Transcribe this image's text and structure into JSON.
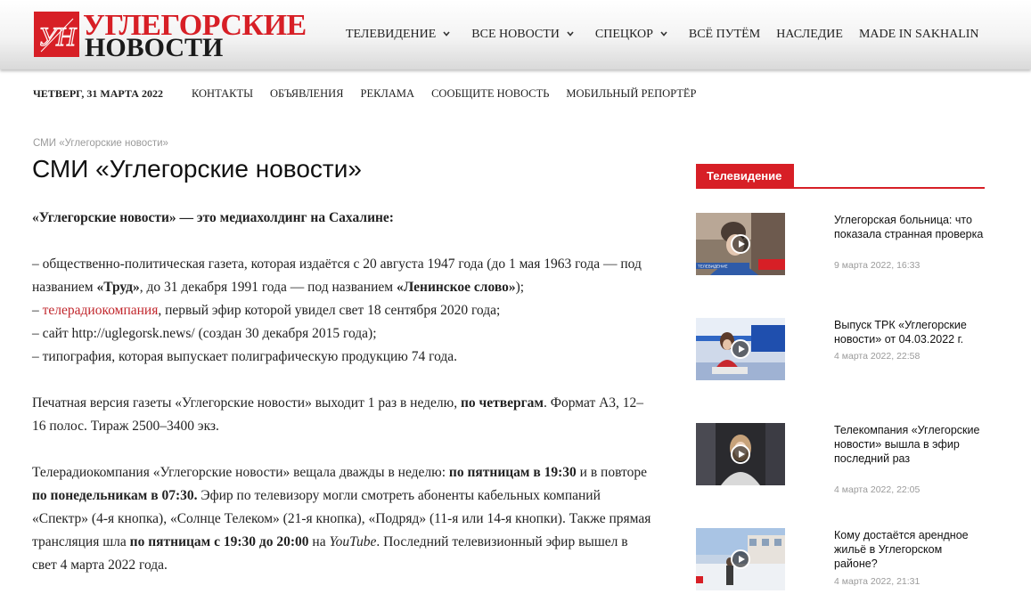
{
  "logo": {
    "line1": "УГЛЕГОРСКИЕ",
    "line2": "НОВОСТИ",
    "mark_text": "УН",
    "brand_color": "#d71f26"
  },
  "main_nav": [
    {
      "label": "ТЕЛЕВИДЕНИЕ",
      "dropdown": true
    },
    {
      "label": "ВСЕ НОВОСТИ",
      "dropdown": true
    },
    {
      "label": "СПЕЦКОР",
      "dropdown": true
    },
    {
      "label": "ВСЁ ПУТЁМ",
      "dropdown": false
    },
    {
      "label": "НАСЛЕДИЕ",
      "dropdown": false
    },
    {
      "label": "MADE IN SAKHALIN",
      "dropdown": false
    }
  ],
  "top_bar": {
    "date": "ЧЕТВЕРГ, 31 МАРТА 2022",
    "links": [
      "КОНТАКТЫ",
      "ОБЪЯВЛЕНИЯ",
      "РЕКЛАМА",
      "СООБЩИТЕ НОВОСТЬ",
      "МОБИЛЬНЫЙ РЕПОРТЁР"
    ]
  },
  "breadcrumb": "СМИ «Углегорские новости»",
  "page_title": "СМИ «Углегорские новости»",
  "article": {
    "intro": "«Углегорские новости» — это медиахолдинг на Сахалине:",
    "l1_a": "– общественно-политическая газета, которая издаётся с 20 августа 1947 года (до 1 мая 1963 года — под названием ",
    "l1_b": "«Труд»",
    "l1_c": ", до 31 декабря 1991 года — под названием ",
    "l1_d": "«Ленинское слово»",
    "l1_e": ");",
    "l2_a": "– ",
    "l2_link": "телерадиокомпания",
    "l2_b": ", первый эфир которой увидел свет 18 сентября 2020 года;",
    "l3": "– сайт http://uglegorsk.news/ (создан 30 декабря 2015 года);",
    "l4": "– типография, которая выпускает полиграфическую продукцию 74 года.",
    "p2_a": "Печатная версия газеты «Углегорские новости» выходит 1 раз в неделю, ",
    "p2_b": "по четвергам",
    "p2_c": ". Формат А3, 12–16 полос. Тираж 2500–3400 экз.",
    "p3_a": "Телерадиокомпания «Углегорские новости» вещала дважды в неделю: ",
    "p3_b": "по пятницам в 19:30",
    "p3_c": " и в повторе ",
    "p3_d": "по понедельникам в 07:30.",
    "p3_e": " Эфир по телевизору могли смотреть абоненты кабельных компаний «Спектр» (4-я кнопка), «Солнце Телеком» (21-я кнопка), «Подряд» (11-я или 14-я кнопки). Также прямая трансляция шла ",
    "p3_f": "по пятницам с 19:30 до 20:00",
    "p3_g": " на ",
    "p3_h": "YouTube",
    "p3_i": ". Последний телевизионный эфир вышел в свет 4 марта 2022 года."
  },
  "sidebar": {
    "tab": "Телевидение",
    "items": [
      {
        "title": "Углегорская больница: что показала странная проверка",
        "date": "9 марта 2022, 16:33",
        "thumb_caption": "ТЕЛЕВИДЕНИЕ"
      },
      {
        "title": "Выпуск ТРК «Углегорские новости» от 04.03.2022 г.",
        "date": "4 марта 2022, 22:58"
      },
      {
        "title": "Телекомпания «Углегорские новости» вышла в эфир последний раз",
        "date": "4 марта 2022, 22:05"
      },
      {
        "title": "Кому достаётся арендное жильё в Углегорском районе?",
        "date": "4 марта 2022, 21:31"
      }
    ]
  },
  "colors": {
    "accent": "#d71f26",
    "link": "#c1272d",
    "muted": "#9a9a9a"
  }
}
